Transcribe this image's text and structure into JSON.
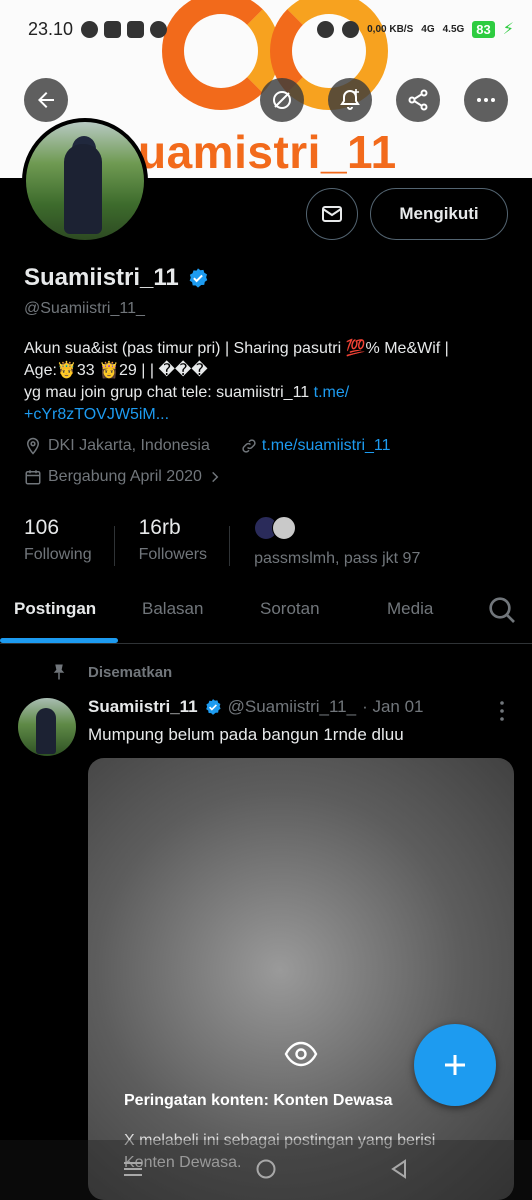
{
  "status_bar": {
    "time": "23.10",
    "network_speed": "0,00 KB/S",
    "signal1": "4G",
    "signal2": "4.5G",
    "battery": "83"
  },
  "banner": {
    "brand_text": "uamistri_11",
    "colors": {
      "orange": "#f26a1b",
      "amber": "#f7a21f"
    }
  },
  "profile": {
    "display_name": "Suamiistri_11",
    "handle": "@Suamiistri_11_",
    "bio_line1": "Akun sua&ist (pas timur pri) | Sharing pasutri 💯% Me&Wif |",
    "bio_line2": "Age:🤴33 👸29 | | ���",
    "bio_line3_prefix": "yg mau join grup chat tele: suamiistri_11 ",
    "bio_link_part1": "t.me/",
    "bio_link_part2": "+cYr8zTOVJW5iM...",
    "location": "DKI Jakarta, Indonesia",
    "website": "t.me/suamiistri_11",
    "joined": "Bergabung April 2020",
    "follow_button": "Mengikuti",
    "following_count": "106",
    "following_label": "Following",
    "followers_count": "16rb",
    "followers_label": "Followers",
    "mutual_followers": "passmslmh, pass jkt 97"
  },
  "tabs": [
    {
      "label": "Postingan",
      "active": true
    },
    {
      "label": "Balasan",
      "active": false
    },
    {
      "label": "Sorotan",
      "active": false
    },
    {
      "label": "Media",
      "active": false
    }
  ],
  "pinned_post": {
    "pinned_label": "Disematkan",
    "author_name": "Suamiistri_11",
    "author_handle": "@Suamiistri_11_",
    "date": "· Jan 01",
    "text": "Mumpung belum pada bangun 1rnde dluu",
    "content_warning_title": "Peringatan konten: Konten Dewasa",
    "content_warning_desc": "X melabeli ini sebagai postingan yang berisi Konten Dewasa."
  },
  "accent_color": "#1d9bf0"
}
